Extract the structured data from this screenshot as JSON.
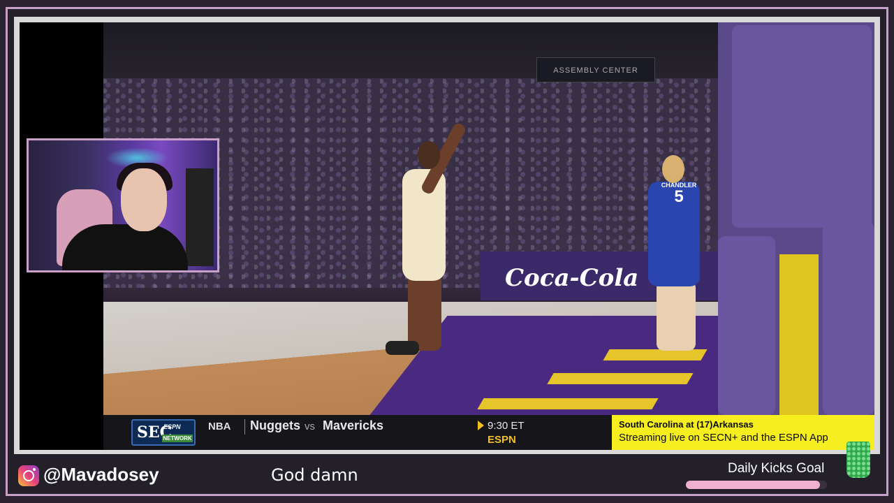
{
  "broadcast": {
    "arena_sign": "ASSEMBLY CENTER",
    "sponsor": "Coca-Cola",
    "player": {
      "name": "CHANDLER",
      "number": "5"
    },
    "ticker": {
      "network_logo": "SEC",
      "network_logo_sub": "ESPN",
      "network_logo_network": "NETWORK",
      "league": "NBA",
      "team1": "Nuggets",
      "vs": "vs",
      "team2": "Mavericks",
      "time": "9:30 ET",
      "channel": "ESPN",
      "promo_line1": "South Carolina at (17)Arkansas",
      "promo_line2": "Streaming live on SECN+ and the ESPN App"
    }
  },
  "overlay": {
    "instagram_handle": "@Mavadosey",
    "caption": "God damn",
    "goal": {
      "label": "Daily Kicks Goal",
      "progress": 0.95
    }
  },
  "colors": {
    "frame_accent": "#c9a0c8",
    "promo_bg": "#f6ee1e",
    "goal_fill": "#f0b0d0",
    "ticker_accent": "#f0c020"
  },
  "icons": [
    "instagram-icon",
    "goal-cup-icon",
    "ticker-arrow-icon"
  ]
}
